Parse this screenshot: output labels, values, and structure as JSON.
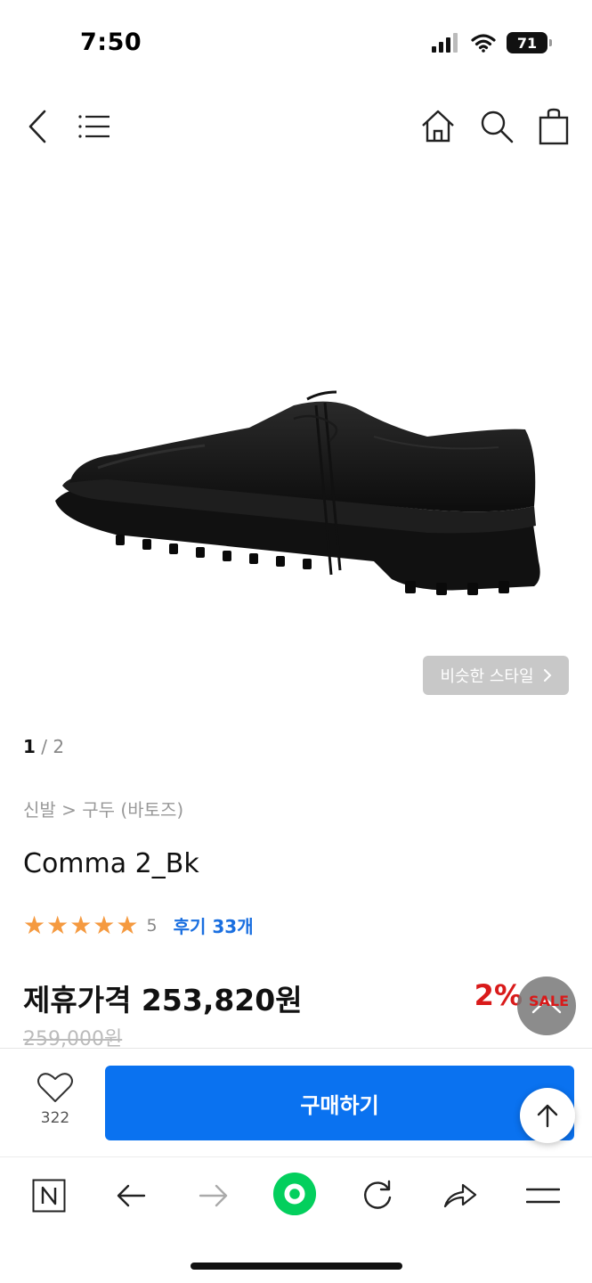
{
  "status_bar": {
    "time": "7:50",
    "battery": "71"
  },
  "navigation": {
    "back_icon": "chevron-left-icon",
    "menu_icon": "menu-lines-icon",
    "home_icon": "home-icon",
    "search_icon": "search-icon",
    "cart_icon": "shopping-bag-icon"
  },
  "gallery": {
    "current_page": "1",
    "separator": " / ",
    "total_pages": "2",
    "similar_style_label": "비슷한 스타일"
  },
  "product": {
    "breadcrumb": "신발 > 구두 (바토즈)",
    "title": "Comma 2_Bk",
    "rating_stars": "★★★★★",
    "rating_score": "5",
    "reviews_label": "후기 33개",
    "price_label": "제휴가격 253,820원",
    "discount_label": "2%",
    "sale_tag": "SALE",
    "original_price": "259,000원"
  },
  "purchase_bar": {
    "like_count": "322",
    "buy_label": "구매하기"
  },
  "colors": {
    "accent_blue": "#0a72f0",
    "star_orange": "#f59a40",
    "sale_red": "#d91a1a",
    "naver_green": "#03cf5d"
  }
}
